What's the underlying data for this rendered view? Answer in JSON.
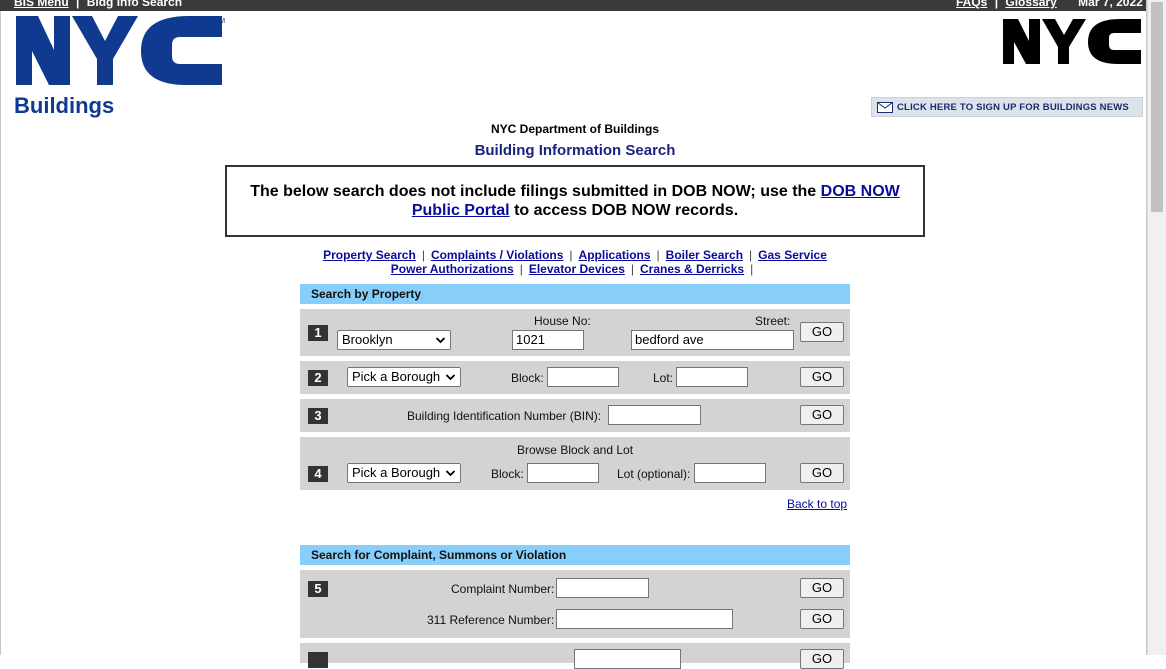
{
  "topbar": {
    "menu_link": "BIS Menu",
    "separator": "|",
    "crumb": "Bldg Info Search",
    "faqs": "FAQs",
    "glossary": "Glossary",
    "date": "Mar 7, 2022"
  },
  "logo": {
    "text": "NYC",
    "subtext": "Buildings",
    "brand_color": "#0f3a8f"
  },
  "news_button": {
    "label": "CLICK HERE TO SIGN UP FOR BUILDINGS NEWS",
    "icon": "envelope-icon"
  },
  "header": {
    "department": "NYC Department of Buildings",
    "title": "Building Information Search"
  },
  "notice": {
    "text_before": "The below search does not include filings submitted in DOB NOW; use the",
    "link_text": "DOB NOW Public Portal",
    "text_after": "to access DOB NOW records."
  },
  "nav_links": {
    "row1": [
      "Property Search",
      "Complaints / Violations",
      "Applications",
      "Boiler Search",
      "Gas Service"
    ],
    "row2": [
      "Power Authorizations",
      "Elevator Devices",
      "Cranes & Derricks"
    ],
    "separator": "|"
  },
  "property_section": {
    "title": "Search by Property",
    "row1": {
      "num": "1",
      "borough_value": "Brooklyn",
      "house_label": "House No:",
      "house_value": "1021",
      "street_label": "Street:",
      "street_value": "bedford ave",
      "go": "GO"
    },
    "row2": {
      "num": "2",
      "borough_value": "Pick a Borough",
      "block_label": "Block:",
      "block_value": "",
      "lot_label": "Lot:",
      "lot_value": "",
      "go": "GO"
    },
    "row3": {
      "num": "3",
      "bin_label": "Building Identification Number (BIN):",
      "bin_value": "",
      "go": "GO"
    },
    "row4": {
      "num": "4",
      "title": "Browse Block and Lot",
      "borough_value": "Pick a Borough",
      "block_label": "Block:",
      "block_value": "",
      "lot_label": "Lot (optional):",
      "lot_value": "",
      "go": "GO"
    },
    "back_to_top": "Back to top"
  },
  "complaint_section": {
    "title": "Search for Complaint, Summons or Violation",
    "row5": {
      "num": "5",
      "complaint_label": "Complaint Number:",
      "complaint_value": "",
      "ref_label": "311 Reference Number:",
      "ref_value": "",
      "go": "GO"
    },
    "row6_go": "GO"
  },
  "colors": {
    "section_header": "#87cefa",
    "row_bg": "#d3d3d3",
    "link": "#0a0a9c",
    "title_blue": "#1a237e"
  }
}
